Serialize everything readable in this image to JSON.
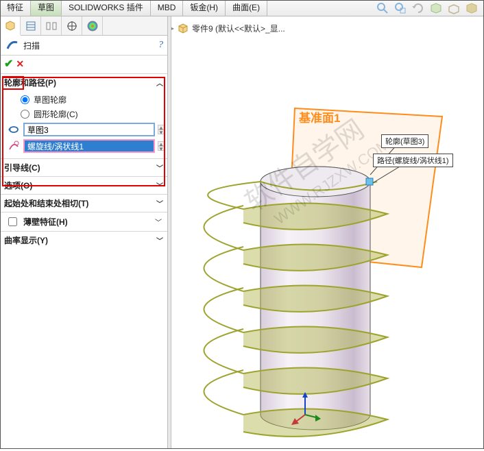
{
  "tabs": {
    "items": [
      "特征",
      "草图",
      "SOLIDWORKS 插件",
      "MBD",
      "钣金(H)",
      "曲面(E)"
    ],
    "active_index": 1
  },
  "breadcrumb": {
    "part": "零件9  (默认<<默认>_显..."
  },
  "feature": {
    "title": "扫描",
    "help_icon": "?"
  },
  "groups": {
    "profile_path": {
      "title": "轮廓和路径(P)",
      "radio_sketch": "草图轮廓",
      "radio_circle": "圆形轮廓(C)",
      "profile_value": "草图3",
      "path_value": "螺旋线/涡状线1"
    },
    "guide": {
      "title": "引导线(C)"
    },
    "options": {
      "title": "选项(O)"
    },
    "tangent": {
      "title": "起始处和结束处相切(T)"
    },
    "thin": {
      "title": "薄壁特征(H)"
    },
    "curvature": {
      "title": "曲率显示(Y)"
    }
  },
  "viewport": {
    "plane_label": "基准面1",
    "callout_profile": "轮廓(草图3)",
    "callout_path": "路径(螺旋线/涡状线1)"
  }
}
